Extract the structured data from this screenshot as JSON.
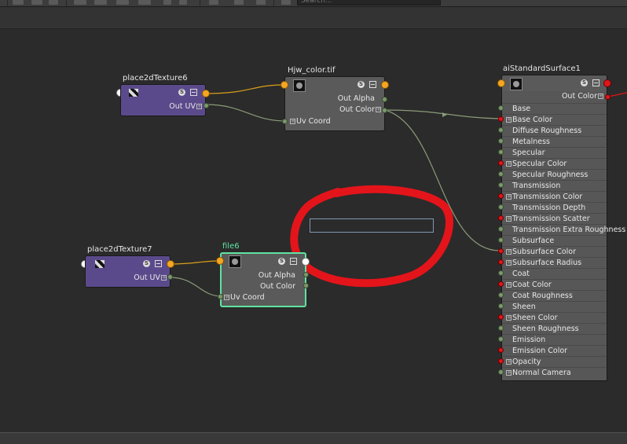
{
  "toolbar": {
    "search_placeholder": "Search..."
  },
  "nodes": {
    "place6": {
      "title": "place2dTexture6",
      "out_uv": "Out UV"
    },
    "place7": {
      "title": "place2dTexture7",
      "out_uv": "Out UV"
    },
    "hjw": {
      "title": "Hjw_color.tif",
      "out_alpha": "Out Alpha",
      "out_color": "Out Color",
      "uv_coord": "Uv Coord"
    },
    "file6": {
      "title": "file6",
      "out_alpha": "Out Alpha",
      "out_color": "Out Color",
      "uv_coord": "Uv Coord"
    },
    "ai": {
      "title": "aiStandardSurface1",
      "out_color": "Out Color",
      "attributes": [
        "Base",
        "Base Color",
        "Diffuse Roughness",
        "Metalness",
        "Specular",
        "Specular Color",
        "Specular Roughness",
        "Transmission",
        "Transmission Color",
        "Transmission Depth",
        "Transmission Scatter",
        "Transmission Extra Roughness",
        "Subsurface",
        "Subsurface Color",
        "Subsurface Radius",
        "Coat",
        "Coat Color",
        "Coat Roughness",
        "Sheen",
        "Sheen Color",
        "Sheen Roughness",
        "Emission",
        "Emission Color",
        "Opacity",
        "Normal Camera"
      ],
      "plugs": [
        "green",
        "red",
        "green",
        "green",
        "green",
        "red",
        "green",
        "green",
        "red",
        "green",
        "red",
        "green",
        "green",
        "red",
        "red",
        "green",
        "red",
        "green",
        "green",
        "red",
        "green",
        "green",
        "red",
        "red",
        "green"
      ],
      "expandable": [
        false,
        true,
        false,
        false,
        false,
        true,
        false,
        false,
        true,
        false,
        true,
        false,
        false,
        true,
        true,
        false,
        true,
        false,
        false,
        true,
        false,
        false,
        false,
        true,
        true
      ]
    }
  },
  "colors": {
    "wire_orange": "#d9a018",
    "wire_green": "#8a9a78",
    "annotation": "#e4141b",
    "accent_select": "#5fe3a1"
  },
  "icons": {
    "swap": "swap-swatch-icon",
    "s": "S"
  }
}
